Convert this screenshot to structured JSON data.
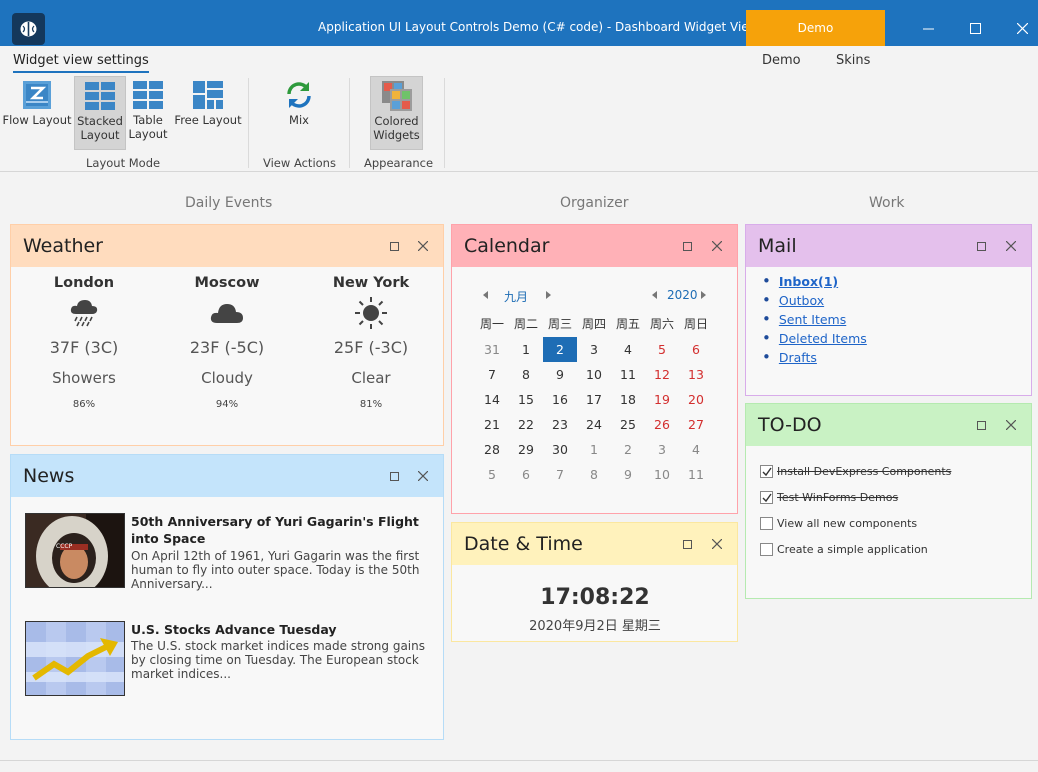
{
  "titlebar": {
    "title": "Application UI Layout Controls Demo (C# code) - Dashboard Widget View",
    "demo_badge": "Demo"
  },
  "ribbon": {
    "tab_label": "Widget view settings",
    "top_links": [
      "Demo",
      "Skins"
    ],
    "buttons": [
      {
        "label1": "Flow Layout",
        "label2": ""
      },
      {
        "label1": "Stacked",
        "label2": "Layout"
      },
      {
        "label1": "Table",
        "label2": "Layout"
      },
      {
        "label1": "Free Layout",
        "label2": ""
      },
      {
        "label1": "Mix",
        "label2": ""
      },
      {
        "label1": "Colored",
        "label2": "Widgets"
      }
    ],
    "groups": [
      "Layout Mode",
      "View Actions",
      "Appearance"
    ]
  },
  "columns": [
    "Daily Events",
    "Organizer",
    "Work"
  ],
  "weather": {
    "title": "Weather",
    "cities": [
      {
        "name": "London",
        "temp": "37F (3C)",
        "condition": "Showers",
        "humidity": "86%",
        "icon": "rain-cloud-icon"
      },
      {
        "name": "Moscow",
        "temp": "23F (-5C)",
        "condition": "Cloudy",
        "humidity": "94%",
        "icon": "cloud-icon"
      },
      {
        "name": "New York",
        "temp": "25F (-3C)",
        "condition": "Clear",
        "humidity": "81%",
        "icon": "sun-icon"
      }
    ]
  },
  "news": {
    "title": "News",
    "items": [
      {
        "title": "50th Anniversary of Yuri Gagarin's Flight into Space",
        "body": "On April 12th of 1961, Yuri Gagarin was the first human to fly into outer space. Today is the 50th Anniversary..."
      },
      {
        "title": "U.S. Stocks Advance Tuesday",
        "body": "The U.S. stock market indices made strong gains by closing time on Tuesday. The European stock market indices..."
      }
    ]
  },
  "calendar": {
    "title": "Calendar",
    "month": "九月",
    "year": "2020",
    "weekdays": [
      "周一",
      "周二",
      "周三",
      "周四",
      "周五",
      "周六",
      "周日"
    ],
    "weeks": [
      [
        "31",
        "1",
        "2",
        "3",
        "4",
        "5",
        "6"
      ],
      [
        "7",
        "8",
        "9",
        "10",
        "11",
        "12",
        "13"
      ],
      [
        "14",
        "15",
        "16",
        "17",
        "18",
        "19",
        "20"
      ],
      [
        "21",
        "22",
        "23",
        "24",
        "25",
        "26",
        "27"
      ],
      [
        "28",
        "29",
        "30",
        "1",
        "2",
        "3",
        "4"
      ],
      [
        "5",
        "6",
        "7",
        "8",
        "9",
        "10",
        "11"
      ]
    ],
    "selected": "2"
  },
  "datetime": {
    "title": "Date & Time",
    "time": "17:08:22",
    "date": "2020年9月2日 星期三"
  },
  "mail": {
    "title": "Mail",
    "items": [
      "Inbox(1)",
      "Outbox",
      "Sent Items",
      "Deleted Items",
      "Drafts"
    ]
  },
  "todo": {
    "title": "TO-DO",
    "items": [
      {
        "label": "Install DevExpress Components",
        "done": true
      },
      {
        "label": "Test WinForms Demos",
        "done": true
      },
      {
        "label": "View all new components",
        "done": false
      },
      {
        "label": "Create a simple application",
        "done": false
      }
    ]
  },
  "colors": {
    "titlebar": "#1e73be",
    "demo_badge": "#f6a20a",
    "weather": "#ffdcbe",
    "news": "#c4e4fb",
    "calendar": "#ffb1b7",
    "datetime": "#fff2bc",
    "mail": "#e4c0ec",
    "todo": "#c9f2c4"
  }
}
